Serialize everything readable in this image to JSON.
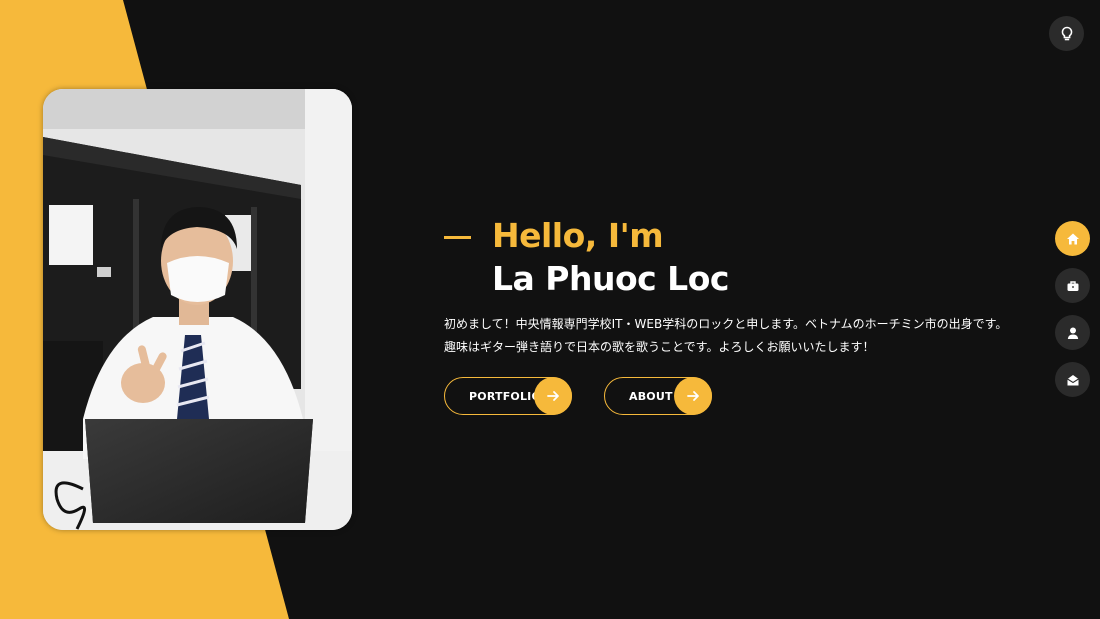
{
  "hero": {
    "greeting": "Hello, I'm",
    "name": "La Phuoc Loc",
    "intro": "初めまして！中央情報専門学校IT・WEB学科のロックと申します。ベトナムのホーチミン市の出身です。趣味はギター弾き語りで日本の歌を歌うことです。よろしくお願いいたします！",
    "buttons": {
      "portfolio": "PORTFOLIO",
      "about": "ABOUT"
    }
  },
  "icons": {
    "theme_toggle": "lightbulb-icon",
    "button_arrow": "arrow-right-icon",
    "nav": [
      "home-icon",
      "briefcase-icon",
      "user-icon",
      "envelope-open-icon"
    ]
  },
  "nav": {
    "active": "home"
  },
  "colors": {
    "accent": "#f6b93b",
    "background": "#111111",
    "nav_button": "#2b2b2b"
  }
}
